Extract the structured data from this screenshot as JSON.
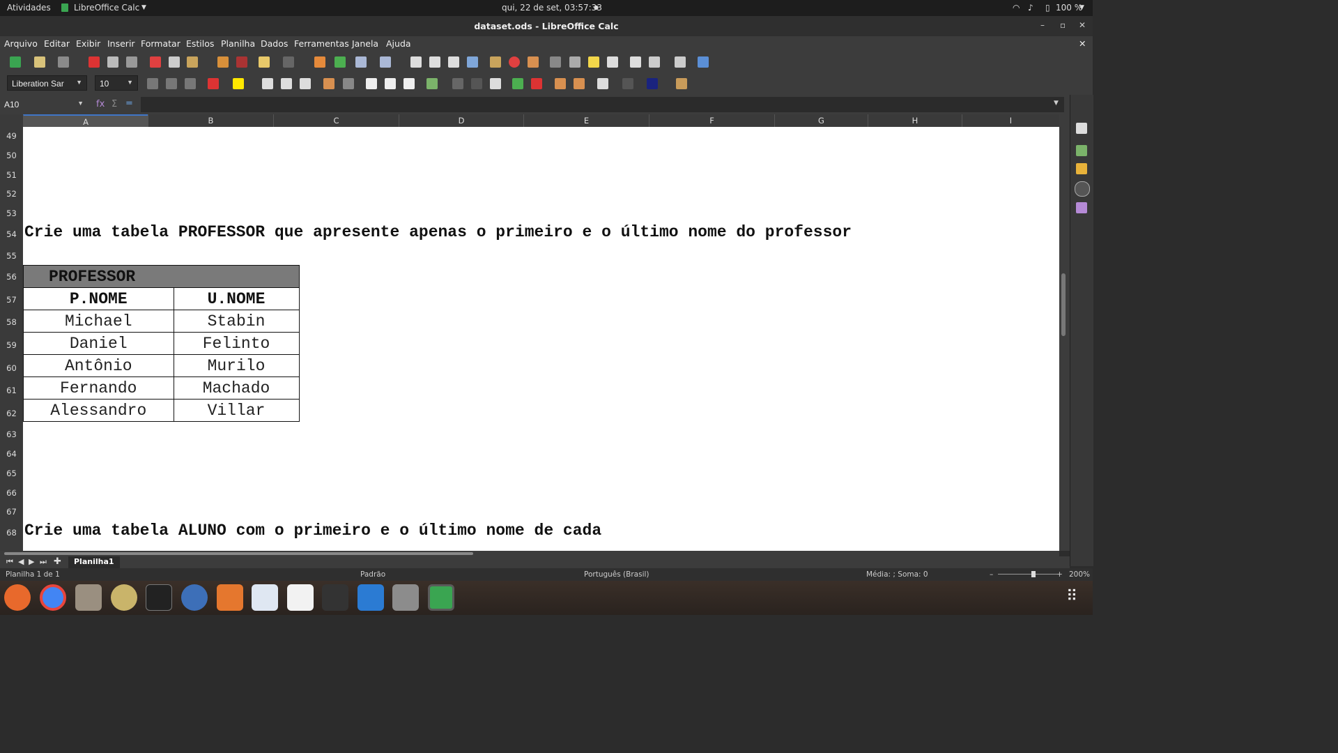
{
  "topbar": {
    "activities": "Atividades",
    "app_name": "LibreOffice Calc",
    "clock": "qui, 22 de set, 03:57:33",
    "battery": "100 %"
  },
  "window": {
    "title": "dataset.ods - LibreOffice Calc"
  },
  "menu": [
    "Arquivo",
    "Editar",
    "Exibir",
    "Inserir",
    "Formatar",
    "Estilos",
    "Planilha",
    "Dados",
    "Ferramentas",
    "Janela",
    "Ajuda"
  ],
  "format_toolbar": {
    "font_name": "Liberation Sar",
    "font_size": "10"
  },
  "formula_bar": {
    "cell_ref": "A10",
    "content": ""
  },
  "columns": [
    "A",
    "B",
    "C",
    "D",
    "E",
    "F",
    "G",
    "H",
    "I"
  ],
  "rows": [
    "49",
    "50",
    "51",
    "52",
    "53",
    "54",
    "55",
    "56",
    "57",
    "58",
    "59",
    "60",
    "61",
    "62",
    "63",
    "64",
    "65",
    "66",
    "67",
    "68"
  ],
  "content": {
    "line1": "Crie uma tabela PROFESSOR que apresente apenas o primeiro e o último nome do professor",
    "line2": "Crie uma tabela ALUNO com o primeiro e o último nome de cada",
    "table": {
      "title": "PROFESSOR",
      "headers": [
        "P.NOME",
        "U.NOME"
      ],
      "rows": [
        [
          "Michael",
          "Stabin"
        ],
        [
          "Daniel",
          "Felinto"
        ],
        [
          "Antônio",
          "Murilo"
        ],
        [
          "Fernando",
          "Machado"
        ],
        [
          "Alessandro",
          "Villar"
        ]
      ]
    }
  },
  "sheet_tab": "Planilha1",
  "status": {
    "sheet": "Planilha 1 de 1",
    "style": "Padrão",
    "language": "Português (Brasil)",
    "sum": "Média: ; Soma: 0",
    "zoom": "200%"
  }
}
